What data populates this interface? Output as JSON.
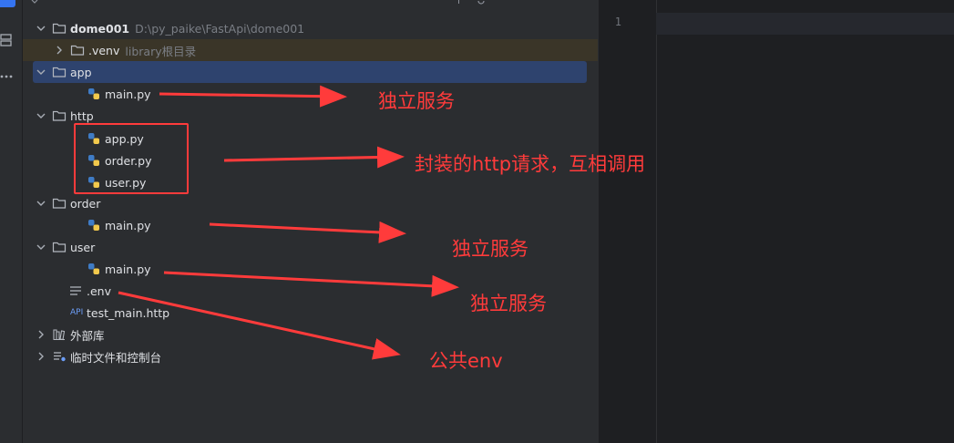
{
  "project_tree": {
    "root": {
      "name": "dome001",
      "path": "D:\\py_paike\\FastApi\\dome001"
    },
    "venv": {
      "name": ".venv",
      "hint": "library根目录"
    },
    "app_folder": "app",
    "app_main": "main.py",
    "http_folder": "http",
    "http_files": [
      "app.py",
      "order.py",
      "user.py"
    ],
    "order_folder": "order",
    "order_main": "main.py",
    "user_folder": "user",
    "user_main": "main.py",
    "env_file": ".env",
    "http_test": "test_main.http",
    "api_badge": "API",
    "external_libs": "外部库",
    "scratches": "临时文件和控制台"
  },
  "editor": {
    "line_number": "1"
  },
  "annotations": {
    "service1": "独立服务",
    "http_note": "封装的http请求，互相调用",
    "service2": "独立服务",
    "service3": "独立服务",
    "env_note": "公共env"
  },
  "colors": {
    "annotation_red": "#ff3b3b",
    "selection": "#2e436e",
    "panel_bg": "#2b2d30",
    "editor_bg": "#1e1f22"
  },
  "icons": [
    "chevron-down-icon",
    "chevron-right-icon",
    "folder-icon",
    "python-file-icon",
    "env-file-icon",
    "library-icon",
    "scratches-icon",
    "structure-icon",
    "more-icon"
  ]
}
